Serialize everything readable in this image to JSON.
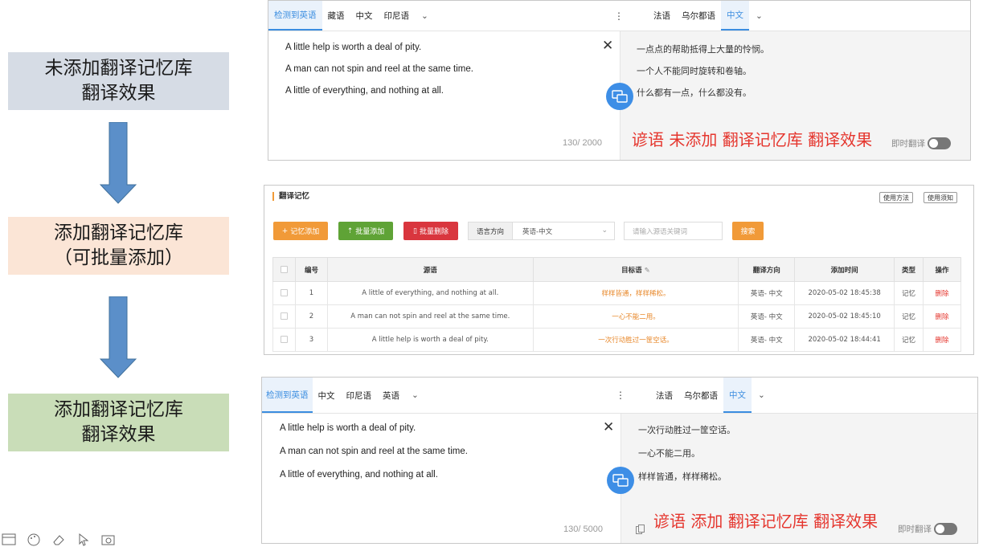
{
  "steps": [
    {
      "line1": "未添加翻译记忆库",
      "line2": "翻译效果"
    },
    {
      "line1": "添加翻译记忆库",
      "line2": "（可批量添加）"
    },
    {
      "line1": "添加翻译记忆库",
      "line2": "翻译效果"
    }
  ],
  "colors": {
    "step1_bg": "#d6dce5",
    "step2_bg": "#fbe5d6",
    "step3_bg": "#c9ddb8",
    "arrow": "#5b8fc9",
    "accent": "#3b8de0",
    "annotation": "#e5362e"
  },
  "panel_before": {
    "source_tabs": [
      "检测到英语",
      "藏语",
      "中文",
      "印尼语"
    ],
    "target_tabs": [
      "法语",
      "乌尔都语",
      "中文"
    ],
    "source_lines": [
      "A little help is worth a deal of pity.",
      "A man can not spin and reel at the same time.",
      "A little of everything, and nothing at all."
    ],
    "target_lines": [
      "一点点的帮助抵得上大量的怜悯。",
      "一个人不能同时旋转和卷轴。",
      "什么都有一点，什么都没有。"
    ],
    "counter": "130/ 2000",
    "annotation": "谚语 未添加 翻译记忆库 翻译效果",
    "instant_label": "即时翻译"
  },
  "memory": {
    "title": "翻译记忆",
    "usage_method": "使用方法",
    "usage_tips": "使用须知",
    "add_button": "记忆添加",
    "batch_add_button": "批量添加",
    "batch_delete_button": "批量删除",
    "direction_label": "语言方向",
    "direction_value": "英语-中文",
    "keyword_placeholder": "请输入源语关键词",
    "search_button": "搜索",
    "columns": [
      "编号",
      "源语",
      "目标语",
      "翻译方向",
      "添加时间",
      "类型",
      "操作"
    ],
    "rows": [
      {
        "id": "1",
        "source": "A little of everything, and nothing at all.",
        "target": "样样皆通，样样稀松。",
        "direction": "英语- 中文",
        "time": "2020-05-02 18:45:38",
        "type": "记忆",
        "action": "删除"
      },
      {
        "id": "2",
        "source": "A man can not spin and reel at the same time.",
        "target": "一心不能二用。",
        "direction": "英语- 中文",
        "time": "2020-05-02 18:45:10",
        "type": "记忆",
        "action": "删除"
      },
      {
        "id": "3",
        "source": "A little help is worth a deal of pity.",
        "target": "一次行动胜过一筐空话。",
        "direction": "英语- 中文",
        "time": "2020-05-02 18:44:41",
        "type": "记忆",
        "action": "删除"
      }
    ]
  },
  "panel_after": {
    "source_tabs": [
      "检测到英语",
      "中文",
      "印尼语",
      "英语"
    ],
    "target_tabs": [
      "法语",
      "乌尔都语",
      "中文"
    ],
    "source_lines": [
      "A little help is worth a deal of pity.",
      "A man can not spin and reel at the same time.",
      "A little of everything, and nothing at all."
    ],
    "target_lines": [
      "一次行动胜过一筐空话。",
      "一心不能二用。",
      "样样皆通，样样稀松。"
    ],
    "counter": "130/ 5000",
    "annotation": "谚语 添加 翻译记忆库 翻译效果",
    "instant_label": "即时翻译"
  }
}
